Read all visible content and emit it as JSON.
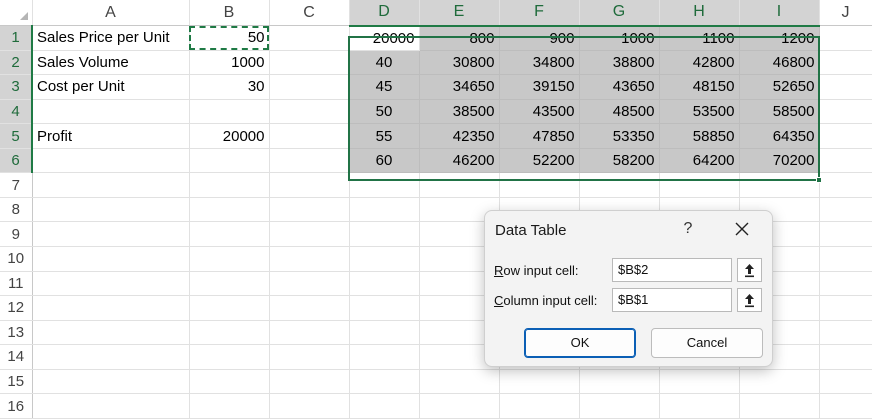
{
  "columns": [
    "A",
    "B",
    "C",
    "D",
    "E",
    "F",
    "G",
    "H",
    "I",
    "J"
  ],
  "rows": [
    {
      "n": "1",
      "A": "Sales Price per Unit",
      "B": "50",
      "D": "20000",
      "E": "800",
      "F": "900",
      "G": "1000",
      "H": "1100",
      "I": "1200"
    },
    {
      "n": "2",
      "A": "Sales Volume",
      "B": "1000",
      "D": "40",
      "E": "30800",
      "F": "34800",
      "G": "38800",
      "H": "42800",
      "I": "46800"
    },
    {
      "n": "3",
      "A": "Cost per Unit",
      "B": "30",
      "D": "45",
      "E": "34650",
      "F": "39150",
      "G": "43650",
      "H": "48150",
      "I": "52650"
    },
    {
      "n": "4",
      "A": "",
      "B": "",
      "D": "50",
      "E": "38500",
      "F": "43500",
      "G": "48500",
      "H": "53500",
      "I": "58500"
    },
    {
      "n": "5",
      "A": "Profit",
      "B": "20000",
      "D": "55",
      "E": "42350",
      "F": "47850",
      "G": "53350",
      "H": "58850",
      "I": "64350"
    },
    {
      "n": "6",
      "A": "",
      "B": "",
      "D": "60",
      "E": "46200",
      "F": "52200",
      "G": "58200",
      "H": "64200",
      "I": "70200"
    },
    {
      "n": "7"
    },
    {
      "n": "8"
    },
    {
      "n": "9"
    },
    {
      "n": "10"
    },
    {
      "n": "11"
    },
    {
      "n": "12"
    },
    {
      "n": "13"
    },
    {
      "n": "14"
    },
    {
      "n": "15"
    },
    {
      "n": "16"
    }
  ],
  "dialog": {
    "title": "Data Table",
    "help_glyph": "?",
    "row_input_label": {
      "accel": "R",
      "rest": "ow input cell:"
    },
    "row_input_value": "$B$2",
    "column_input_label": {
      "accel": "C",
      "rest": "olumn input cell:"
    },
    "column_input_value": "$B$1",
    "ok_label": "OK",
    "cancel_label": "Cancel"
  },
  "colors": {
    "accent": "#217346",
    "selection_shade": "#c8c8c8",
    "ok_border": "#0b5fb5"
  }
}
